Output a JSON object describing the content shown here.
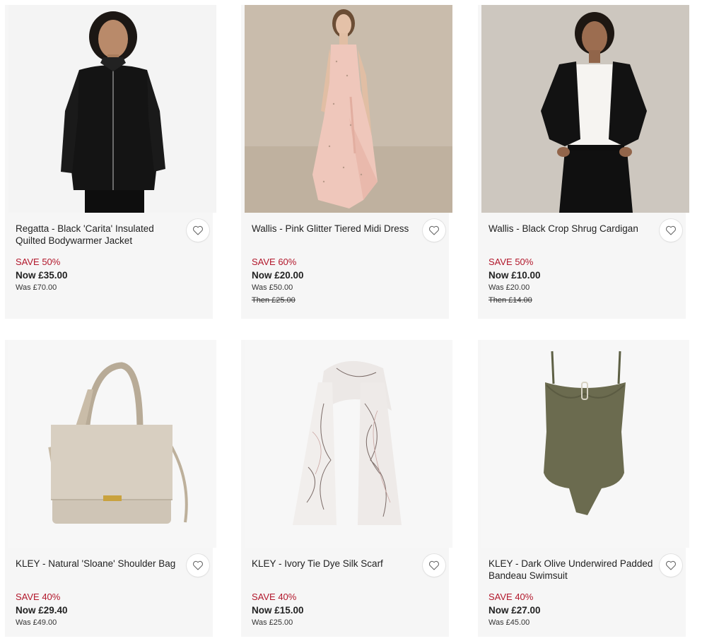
{
  "products": [
    {
      "title": "Regatta - Black 'Carita' Insulated Quilted Bodywarmer Jacket",
      "save": "SAVE 50%",
      "now": "Now £35.00",
      "was": "Was £70.00",
      "then": ""
    },
    {
      "title": "Wallis - Pink Glitter Tiered Midi Dress",
      "save": "SAVE 60%",
      "now": "Now £20.00",
      "was": "Was £50.00",
      "then": "Then £25.00"
    },
    {
      "title": "Wallis - Black Crop Shrug Cardigan",
      "save": "SAVE 50%",
      "now": "Now £10.00",
      "was": "Was £20.00",
      "then": "Then £14.00"
    },
    {
      "title": "KLEY - Natural 'Sloane' Shoulder Bag",
      "save": "SAVE 40%",
      "now": "Now £29.40",
      "was": "Was £49.00",
      "then": ""
    },
    {
      "title": "KLEY - Ivory Tie Dye Silk Scarf",
      "save": "SAVE 40%",
      "now": "Now £15.00",
      "was": "Was £25.00",
      "then": ""
    },
    {
      "title": "KLEY - Dark Olive Underwired Padded Bandeau Swimsuit",
      "save": "SAVE 40%",
      "now": "Now £27.00",
      "was": "Was £45.00",
      "then": ""
    }
  ],
  "icons": {
    "wishlist": "heart-outline-icon"
  },
  "colors": {
    "save": "#b2172b",
    "card_bg": "#f6f6f6"
  }
}
